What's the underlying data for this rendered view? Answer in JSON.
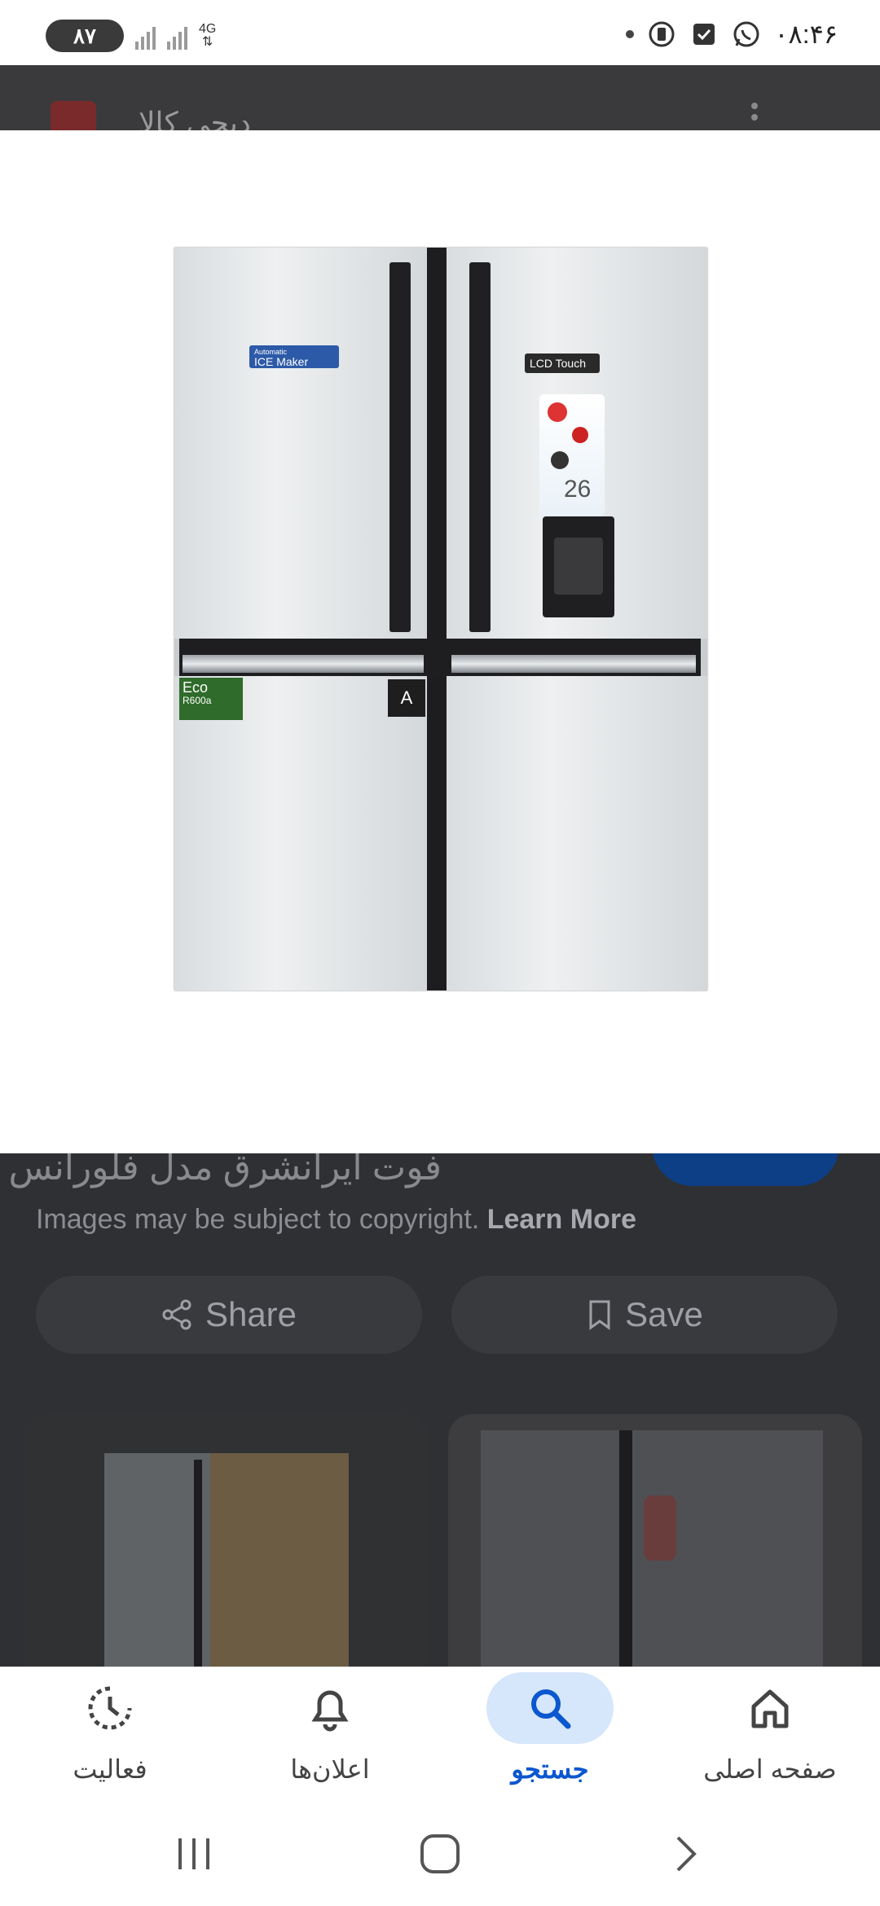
{
  "status_bar": {
    "battery": "۸۷",
    "network": "4G",
    "time": "۰۸:۴۶"
  },
  "app_header": {
    "title": "دیجی کالا"
  },
  "image": {
    "alt": "Refrigerator",
    "stickers": {
      "ice_maker_small": "Automatic",
      "ice_maker": "ICE Maker",
      "lcd_touch": "LCD Touch",
      "eco": "Eco",
      "refrigerant": "R600a",
      "energy_class": "A",
      "number": "26"
    }
  },
  "result": {
    "title": "فوت ایرانشرق مدل فلورانس",
    "copyright_text": "Images may be subject to copyright.",
    "learn_more": "Learn More",
    "share_label": "Share",
    "save_label": "Save"
  },
  "bottom_nav": {
    "items": [
      {
        "label": "فعالیت",
        "icon": "activity-icon",
        "active": false
      },
      {
        "label": "اعلان‌ها",
        "icon": "bell-icon",
        "active": false
      },
      {
        "label": "جستجو",
        "icon": "search-icon",
        "active": true
      },
      {
        "label": "صفحه اصلی",
        "icon": "home-icon",
        "active": false
      }
    ]
  },
  "colors": {
    "accent": "#0b57d0",
    "active_pill": "#d6e6fb",
    "scrim": "#2f3033"
  }
}
